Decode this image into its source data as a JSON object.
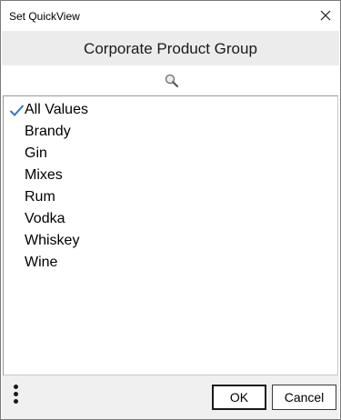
{
  "window": {
    "title": "Set QuickView",
    "close_icon": "close-icon"
  },
  "header": {
    "title": "Corporate Product Group"
  },
  "search": {
    "icon": "search-icon"
  },
  "list": {
    "items": [
      {
        "label": "All Values",
        "checked": true
      },
      {
        "label": "Brandy",
        "checked": false
      },
      {
        "label": "Gin",
        "checked": false
      },
      {
        "label": "Mixes",
        "checked": false
      },
      {
        "label": "Rum",
        "checked": false
      },
      {
        "label": "Vodka",
        "checked": false
      },
      {
        "label": "Whiskey",
        "checked": false
      },
      {
        "label": "Wine",
        "checked": false
      }
    ],
    "check_color": "#2b78d8"
  },
  "footer": {
    "menu_icon": "more-vertical-icon",
    "ok_label": "OK",
    "cancel_label": "Cancel"
  }
}
